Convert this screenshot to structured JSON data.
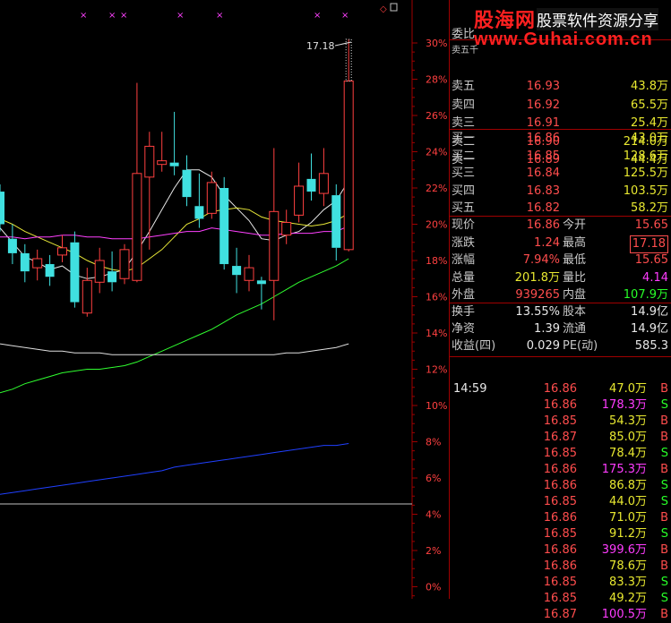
{
  "colors": {
    "up": "#ff4040",
    "down": "#40e0e0",
    "ma5": "#e8e8e8",
    "ma10": "#e8e838",
    "ma20": "#ff40ff",
    "ma30": "#30ff30",
    "ma60": "#e0e0e0",
    "ma120": "#2040ff",
    "axis": "#a00000",
    "axis_text": "#ff4040"
  },
  "chart_data": {
    "type": "candlestick",
    "y_axis_ticks": [
      "30%",
      "28%",
      "26%",
      "24%",
      "22%",
      "20%",
      "18%",
      "16%",
      "14%",
      "12%",
      "10%",
      "8%",
      "6%",
      "4%",
      "2%",
      "0%"
    ],
    "ylim": [
      0,
      30
    ],
    "max_label": "17.18",
    "candles": [
      {
        "open": 21.8,
        "close": 20.0,
        "high": 22.2,
        "low": 19.6
      },
      {
        "open": 19.2,
        "close": 18.4,
        "high": 20.0,
        "low": 17.8
      },
      {
        "open": 18.4,
        "close": 17.4,
        "high": 18.9,
        "low": 16.8
      },
      {
        "open": 17.6,
        "close": 18.1,
        "high": 18.6,
        "low": 16.9
      },
      {
        "open": 17.8,
        "close": 17.1,
        "high": 18.3,
        "low": 16.6
      },
      {
        "open": 18.3,
        "close": 18.7,
        "high": 19.4,
        "low": 17.9
      },
      {
        "open": 19.0,
        "close": 15.7,
        "high": 19.6,
        "low": 15.4
      },
      {
        "open": 15.1,
        "close": 16.9,
        "high": 17.6,
        "low": 14.9
      },
      {
        "open": 16.8,
        "close": 18.0,
        "high": 18.7,
        "low": 16.2
      },
      {
        "open": 17.4,
        "close": 16.8,
        "high": 18.5,
        "low": 16.3
      },
      {
        "open": 17.0,
        "close": 18.6,
        "high": 18.9,
        "low": 16.7
      },
      {
        "open": 16.9,
        "close": 22.8,
        "high": 27.8,
        "low": 16.8
      },
      {
        "open": 22.6,
        "close": 24.3,
        "high": 25.1,
        "low": 18.6
      },
      {
        "open": 23.3,
        "close": 23.5,
        "high": 25.1,
        "low": 22.9
      },
      {
        "open": 23.4,
        "close": 23.2,
        "high": 26.2,
        "low": 22.7
      },
      {
        "open": 23.0,
        "close": 21.5,
        "high": 23.8,
        "low": 21.0
      },
      {
        "open": 21.0,
        "close": 20.3,
        "high": 22.8,
        "low": 19.8
      },
      {
        "open": 20.6,
        "close": 22.3,
        "high": 22.9,
        "low": 20.3
      },
      {
        "open": 22.0,
        "close": 17.8,
        "high": 22.6,
        "low": 17.5
      },
      {
        "open": 17.7,
        "close": 17.2,
        "high": 18.7,
        "low": 16.2
      },
      {
        "open": 16.9,
        "close": 17.6,
        "high": 18.3,
        "low": 16.3
      },
      {
        "open": 16.9,
        "close": 16.7,
        "high": 17.1,
        "low": 15.3
      },
      {
        "open": 16.9,
        "close": 20.7,
        "high": 24.2,
        "low": 14.7
      },
      {
        "open": 19.4,
        "close": 20.1,
        "high": 20.8,
        "low": 18.9
      },
      {
        "open": 20.5,
        "close": 22.1,
        "high": 23.4,
        "low": 20.1
      },
      {
        "open": 22.5,
        "close": 21.8,
        "high": 23.9,
        "low": 21.3
      },
      {
        "open": 21.7,
        "close": 22.8,
        "high": 24.2,
        "low": 21.0
      },
      {
        "open": 21.6,
        "close": 18.7,
        "high": 22.2,
        "low": 18.0
      },
      {
        "open": 18.6,
        "close": 27.9,
        "high": 30.2,
        "low": 18.5
      }
    ],
    "ma_lines": [
      {
        "name": "MA5",
        "values": [
          19.8,
          19.0,
          18.2,
          17.9,
          17.5,
          17.7,
          17.2,
          17.0,
          17.1,
          17.3,
          17.5,
          18.5,
          19.6,
          20.8,
          22.0,
          23.0,
          23.0,
          22.6,
          21.6,
          20.9,
          20.2,
          19.2,
          19.1,
          19.4,
          19.6,
          20.1,
          20.8,
          21.3,
          22.4
        ]
      },
      {
        "name": "MA10",
        "values": [
          20.3,
          20.0,
          19.6,
          19.3,
          19.0,
          18.7,
          18.4,
          18.0,
          17.7,
          17.5,
          17.4,
          17.6,
          18.1,
          18.6,
          19.3,
          20.0,
          20.3,
          20.7,
          20.8,
          20.9,
          20.8,
          20.4,
          20.2,
          20.1,
          20.0,
          19.9,
          20.0,
          20.2,
          20.6
        ]
      },
      {
        "name": "MA20",
        "values": [
          19.3,
          19.3,
          19.2,
          19.3,
          19.3,
          19.4,
          19.4,
          19.3,
          19.3,
          19.2,
          19.2,
          19.2,
          19.3,
          19.4,
          19.5,
          19.6,
          19.6,
          19.8,
          19.7,
          19.6,
          19.5,
          19.4,
          19.4,
          19.5,
          19.5,
          19.5,
          19.6,
          19.6,
          19.9
        ]
      },
      {
        "name": "MA30",
        "values": [
          10.7,
          10.9,
          11.2,
          11.4,
          11.6,
          11.8,
          11.9,
          12.0,
          12.0,
          12.1,
          12.2,
          12.4,
          12.7,
          13.0,
          13.3,
          13.6,
          13.9,
          14.2,
          14.6,
          15.0,
          15.3,
          15.6,
          16.0,
          16.4,
          16.8,
          17.1,
          17.4,
          17.7,
          18.1
        ]
      },
      {
        "name": "MA60",
        "values": [
          13.4,
          13.3,
          13.2,
          13.1,
          13.0,
          13.0,
          12.9,
          12.9,
          12.9,
          12.8,
          12.8,
          12.8,
          12.8,
          12.8,
          12.8,
          12.8,
          12.8,
          12.8,
          12.8,
          12.8,
          12.8,
          12.8,
          12.8,
          12.9,
          12.9,
          13.0,
          13.1,
          13.2,
          13.4
        ]
      },
      {
        "name": "MA120",
        "values": [
          5.1,
          5.2,
          5.3,
          5.4,
          5.5,
          5.6,
          5.7,
          5.8,
          5.9,
          6.0,
          6.1,
          6.2,
          6.3,
          6.4,
          6.6,
          6.7,
          6.8,
          6.9,
          7.0,
          7.1,
          7.2,
          7.3,
          7.4,
          7.5,
          7.6,
          7.7,
          7.8,
          7.8,
          7.9
        ]
      }
    ],
    "top_markers": [
      "×",
      "×",
      "×",
      "×",
      "×",
      "×",
      "×"
    ],
    "top_right_marker": "◇"
  },
  "watermark": {
    "brand": "股海网",
    "slogan": "股票软件资源分享",
    "url": "www.Guhai.com.cn"
  },
  "quote": {
    "header_label": "委比",
    "header_partial": "卖五千",
    "asks": [
      {
        "label": "卖五",
        "price": "16.93",
        "vol": "43.8万"
      },
      {
        "label": "卖四",
        "price": "16.92",
        "vol": "65.5万"
      },
      {
        "label": "卖三",
        "price": "16.91",
        "vol": "25.4万"
      },
      {
        "label": "卖二",
        "price": "16.90",
        "vol": "214.0万"
      },
      {
        "label": "卖一",
        "price": "16.89",
        "vol": "44.4万"
      }
    ],
    "bids": [
      {
        "label": "买一",
        "price": "16.86",
        "vol": "43.0万"
      },
      {
        "label": "买二",
        "price": "16.85",
        "vol": "128.6万"
      },
      {
        "label": "买三",
        "price": "16.84",
        "vol": "125.5万"
      },
      {
        "label": "买四",
        "price": "16.83",
        "vol": "103.5万"
      },
      {
        "label": "买五",
        "price": "16.82",
        "vol": "58.2万"
      }
    ],
    "stats": [
      {
        "l1": "现价",
        "v1": "16.86",
        "l2": "今开",
        "v2": "15.65"
      },
      {
        "l1": "涨跌",
        "v1": "1.24",
        "l2": "最高",
        "v2": "17.18"
      },
      {
        "l1": "涨幅",
        "v1": "7.94%",
        "l2": "最低",
        "v2": "15.65"
      },
      {
        "l1": "总量",
        "v1": "201.8万",
        "l2": "量比",
        "v2": "4.14"
      },
      {
        "l1": "外盘",
        "v1": "939265",
        "l2": "内盘",
        "v2": "107.9万"
      }
    ],
    "fund": [
      {
        "l1": "换手",
        "v1": "13.55%",
        "l2": "股本",
        "v2": "14.9亿"
      },
      {
        "l1": "净资",
        "v1": "1.39",
        "l2": "流通",
        "v2": "14.9亿"
      },
      {
        "l1": "收益(四)",
        "v1": "0.029",
        "l2": "PE(动)",
        "v2": "585.3"
      }
    ],
    "ticks_time": "14:59",
    "ticks": [
      {
        "price": "16.86",
        "vol": "47.0万",
        "side": "B"
      },
      {
        "price": "16.86",
        "vol": "178.3万",
        "side": "S"
      },
      {
        "price": "16.85",
        "vol": "54.3万",
        "side": "B"
      },
      {
        "price": "16.87",
        "vol": "85.0万",
        "side": "B"
      },
      {
        "price": "16.85",
        "vol": "78.4万",
        "side": "S"
      },
      {
        "price": "16.86",
        "vol": "175.3万",
        "side": "B"
      },
      {
        "price": "16.86",
        "vol": "86.8万",
        "side": "S"
      },
      {
        "price": "16.85",
        "vol": "44.0万",
        "side": "S"
      },
      {
        "price": "16.86",
        "vol": "71.0万",
        "side": "B"
      },
      {
        "price": "16.85",
        "vol": "91.2万",
        "side": "S"
      },
      {
        "price": "16.86",
        "vol": "399.6万",
        "side": "B"
      },
      {
        "price": "16.86",
        "vol": "78.6万",
        "side": "B"
      },
      {
        "price": "16.85",
        "vol": "83.3万",
        "side": "S"
      },
      {
        "price": "16.85",
        "vol": "49.2万",
        "side": "S"
      },
      {
        "price": "16.87",
        "vol": "100.5万",
        "side": "B"
      }
    ]
  }
}
